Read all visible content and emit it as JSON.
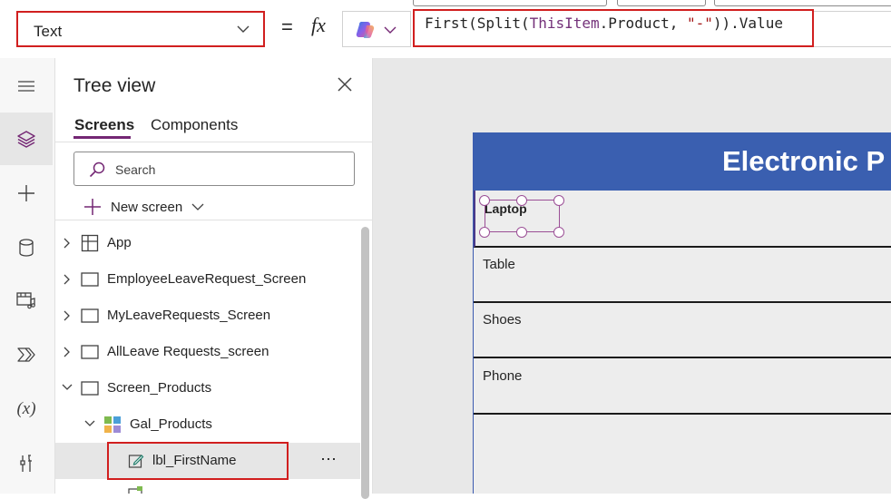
{
  "formula_bar": {
    "property": "Text",
    "equals": "=",
    "fx": "fx",
    "formula_tokens": [
      {
        "text": "First(Split(",
        "kind": "plain"
      },
      {
        "text": "ThisItem",
        "kind": "kw"
      },
      {
        "text": ".Product, ",
        "kind": "plain"
      },
      {
        "text": "\"-\"",
        "kind": "str"
      },
      {
        "text": ")).Value",
        "kind": "plain"
      }
    ]
  },
  "rail": {
    "items": [
      {
        "icon": "hamburger-icon"
      },
      {
        "icon": "layers-icon",
        "active": true
      },
      {
        "icon": "plus-icon"
      },
      {
        "icon": "database-icon"
      },
      {
        "icon": "media-icon"
      },
      {
        "icon": "power-automate-icon"
      },
      {
        "icon": "variables-icon",
        "label": "(x)"
      },
      {
        "icon": "tools-icon"
      }
    ]
  },
  "tree": {
    "title": "Tree view",
    "tabs": [
      "Screens",
      "Components"
    ],
    "search_placeholder": "Search",
    "new_screen": "New screen",
    "nodes": [
      {
        "label": "App",
        "icon": "app-icon",
        "expand": "collapsed"
      },
      {
        "label": "EmployeeLeaveRequest_Screen",
        "icon": "screen-icon",
        "expand": "collapsed"
      },
      {
        "label": "MyLeaveRequests_Screen",
        "icon": "screen-icon",
        "expand": "collapsed"
      },
      {
        "label": "AllLeave Requests_screen",
        "icon": "screen-icon",
        "expand": "collapsed"
      },
      {
        "label": "Screen_Products",
        "icon": "screen-icon",
        "expand": "expanded"
      },
      {
        "label": "Gal_Products",
        "icon": "gallery-icon",
        "expand": "expanded"
      },
      {
        "label": "lbl_FirstName",
        "icon": "label-edit-icon",
        "selected": true,
        "more": "⋯"
      }
    ]
  },
  "canvas": {
    "header_title": "Electronic P",
    "gallery_items": [
      "Laptop",
      "Table",
      "Shoes",
      "Phone"
    ]
  },
  "colors": {
    "accent": "#742774",
    "header": "#3a5fb0",
    "highlight": "#d11f1f"
  }
}
